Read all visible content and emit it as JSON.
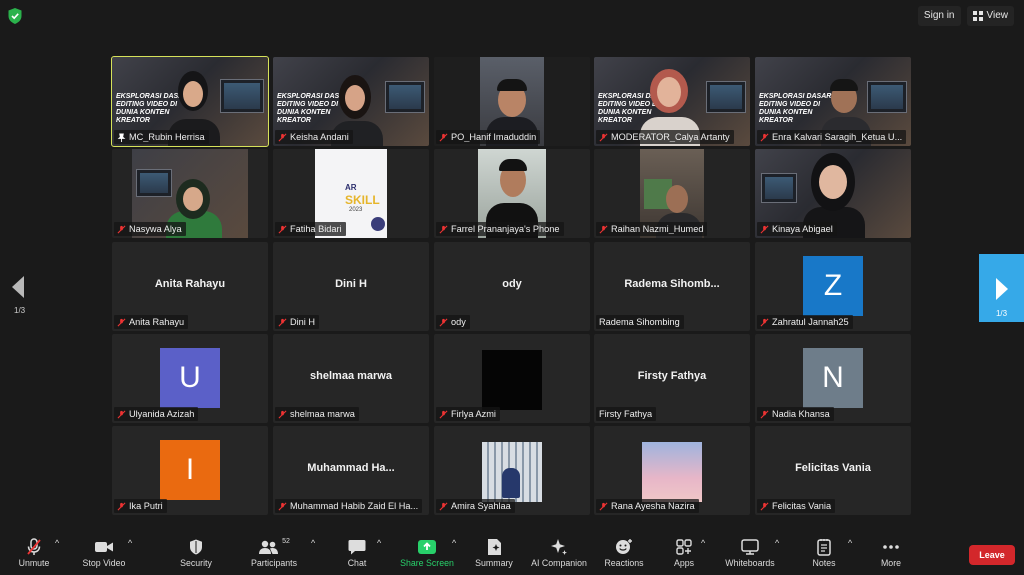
{
  "top": {
    "sign_in": "Sign in",
    "view": "View"
  },
  "pagination": {
    "left": "1/3",
    "right": "1/3"
  },
  "tiles": [
    {
      "name": "MC_Rubin Herrisa",
      "icon": "pin-icon"
    },
    {
      "name": "Keisha Andani"
    },
    {
      "name": "PO_Hanif Imaduddin"
    },
    {
      "name": "MODERATOR_Calya Artanty"
    },
    {
      "name": "Enra Kalvari Saragih_Ketua U..."
    },
    {
      "name": "Nasywa Alya"
    },
    {
      "name": "Fatiha Bidari"
    },
    {
      "name": "Farrel Prananjaya's Phone"
    },
    {
      "name": "Raihan Nazmi_Humed"
    },
    {
      "name": "Kinaya Abigael"
    },
    {
      "name": "Anita Rahayu",
      "display": "Anita Rahayu"
    },
    {
      "name": "Dini H",
      "display": "Dini H"
    },
    {
      "name": "ody",
      "display": "ody"
    },
    {
      "name": "Radema Sihombing",
      "display": "Radema  Sihomb..."
    },
    {
      "name": "Zahratul Jannah25",
      "avatar": "Z",
      "color": "#1878c8"
    },
    {
      "name": "Ulyanida Azizah",
      "avatar": "U",
      "color": "#5b60c8"
    },
    {
      "name": "shelmaa marwa",
      "display": "shelmaa marwa"
    },
    {
      "name": "Firlya Azmi"
    },
    {
      "name": "Firsty Fathya",
      "display": "Firsty Fathya"
    },
    {
      "name": "Nadia Khansa",
      "avatar": "N",
      "color": "#6e7d8a"
    },
    {
      "name": "Ika Putri",
      "avatar": "I",
      "color": "#ea6a10"
    },
    {
      "name": "Muhammad Habib Zaid El Ha...",
      "display": "Muhammad  Ha..."
    },
    {
      "name": "Amira Syahlaa"
    },
    {
      "name": "Rana Ayesha Nazira"
    },
    {
      "name": "Felicitas Vania",
      "display": "Felicitas Vania"
    }
  ],
  "slide_text": {
    "line1": "EKSPLORASI DASAR",
    "line2": "EDITING VIDEO DI",
    "line3": "DUNIA KONTEN",
    "line4": "KREATOR",
    "skill": "SKILL",
    "ar": "AR",
    "year": "2023"
  },
  "toolbar": {
    "unmute": "Unmute",
    "stop_video": "Stop Video",
    "security": "Security",
    "participants": "Participants",
    "participants_count": "52",
    "chat": "Chat",
    "share_screen": "Share Screen",
    "summary": "Summary",
    "ai_companion": "AI Companion",
    "reactions": "Reactions",
    "apps": "Apps",
    "whiteboards": "Whiteboards",
    "notes": "Notes",
    "more": "More",
    "leave": "Leave"
  },
  "colors": {
    "accent": "#36a9e8",
    "leave": "#d3272b",
    "active_speaker": "#d6e25a",
    "share_green": "#28d06a"
  }
}
